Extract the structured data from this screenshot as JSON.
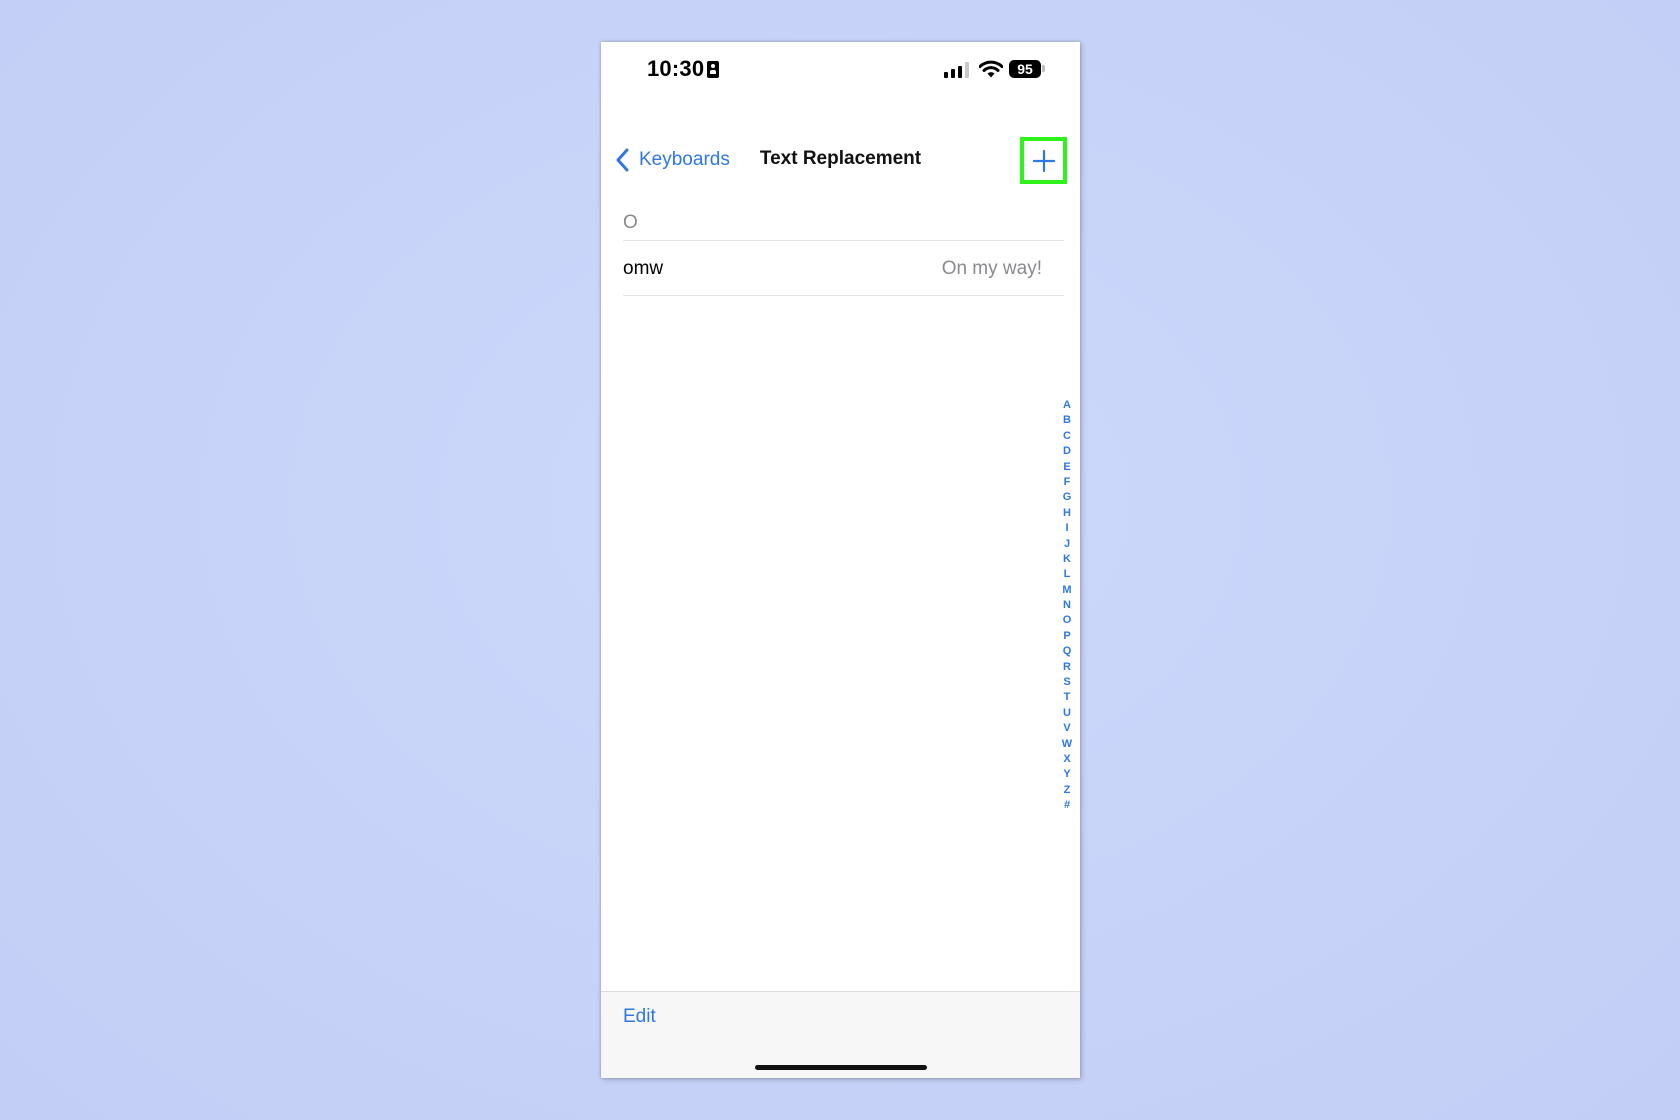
{
  "status_bar": {
    "time": "10:30",
    "battery": "95"
  },
  "nav": {
    "back_label": "Keyboards",
    "title": "Text Replacement",
    "add_icon": "plus-icon"
  },
  "list": {
    "section_header": "O",
    "rows": [
      {
        "shortcut": "omw",
        "phrase": "On my way!"
      }
    ]
  },
  "index_letters": [
    "A",
    "B",
    "C",
    "D",
    "E",
    "F",
    "G",
    "H",
    "I",
    "J",
    "K",
    "L",
    "M",
    "N",
    "O",
    "P",
    "Q",
    "R",
    "S",
    "T",
    "U",
    "V",
    "W",
    "X",
    "Y",
    "Z",
    "#"
  ],
  "toolbar": {
    "edit_label": "Edit"
  },
  "colors": {
    "accent": "#2f78e4",
    "highlight": "#2ef21a",
    "background": "#c9d5f8"
  }
}
